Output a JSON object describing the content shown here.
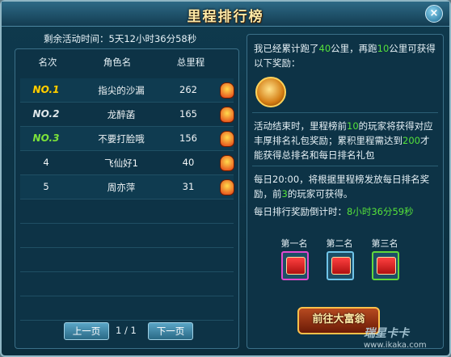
{
  "window": {
    "title": "里程排行榜",
    "close_glyph": "×"
  },
  "countdown": {
    "label": "剩余活动时间：",
    "value": "5天12小时36分58秒"
  },
  "table": {
    "headers": [
      "名次",
      "角色名",
      "总里程"
    ],
    "rows": [
      {
        "rank": "NO.1",
        "name": "指尖的沙漏",
        "distance": "262"
      },
      {
        "rank": "NO.2",
        "name": "龙醉菡",
        "distance": "165"
      },
      {
        "rank": "NO.3",
        "name": "不要打脸哦",
        "distance": "156"
      },
      {
        "rank": "4",
        "name": "飞仙好1",
        "distance": "40"
      },
      {
        "rank": "5",
        "name": "周亦萍",
        "distance": "31"
      }
    ]
  },
  "pager": {
    "prev": "上一页",
    "page": "1 / 1",
    "next": "下一页"
  },
  "info": {
    "line1_a": "我已经累计跑了",
    "line1_km": "40",
    "line1_b": "公里，再跑",
    "line1_km2": "10",
    "line1_c": "公里可获得以下奖励：",
    "para2_a": "活动结束时，里程榜前",
    "para2_n": "10",
    "para2_b": "的玩家将获得对应丰厚排名礼包奖励；累积里程需达到",
    "para2_n2": "200",
    "para2_c": "才能获得总排名和每日排名礼包",
    "para3_a": "每日20:00，将根据里程榜发放每日排名奖励，前",
    "para3_n": "3",
    "para3_b": "的玩家可获得。",
    "daily_label": "每日排行奖励倒计时：",
    "daily_value": "8小时36分59秒"
  },
  "tiers": [
    "第一名",
    "第二名",
    "第三名"
  ],
  "go_button": "前往大富翁",
  "watermark": {
    "brand": "瑞星卡卡",
    "url": "www.ikaka.com"
  }
}
